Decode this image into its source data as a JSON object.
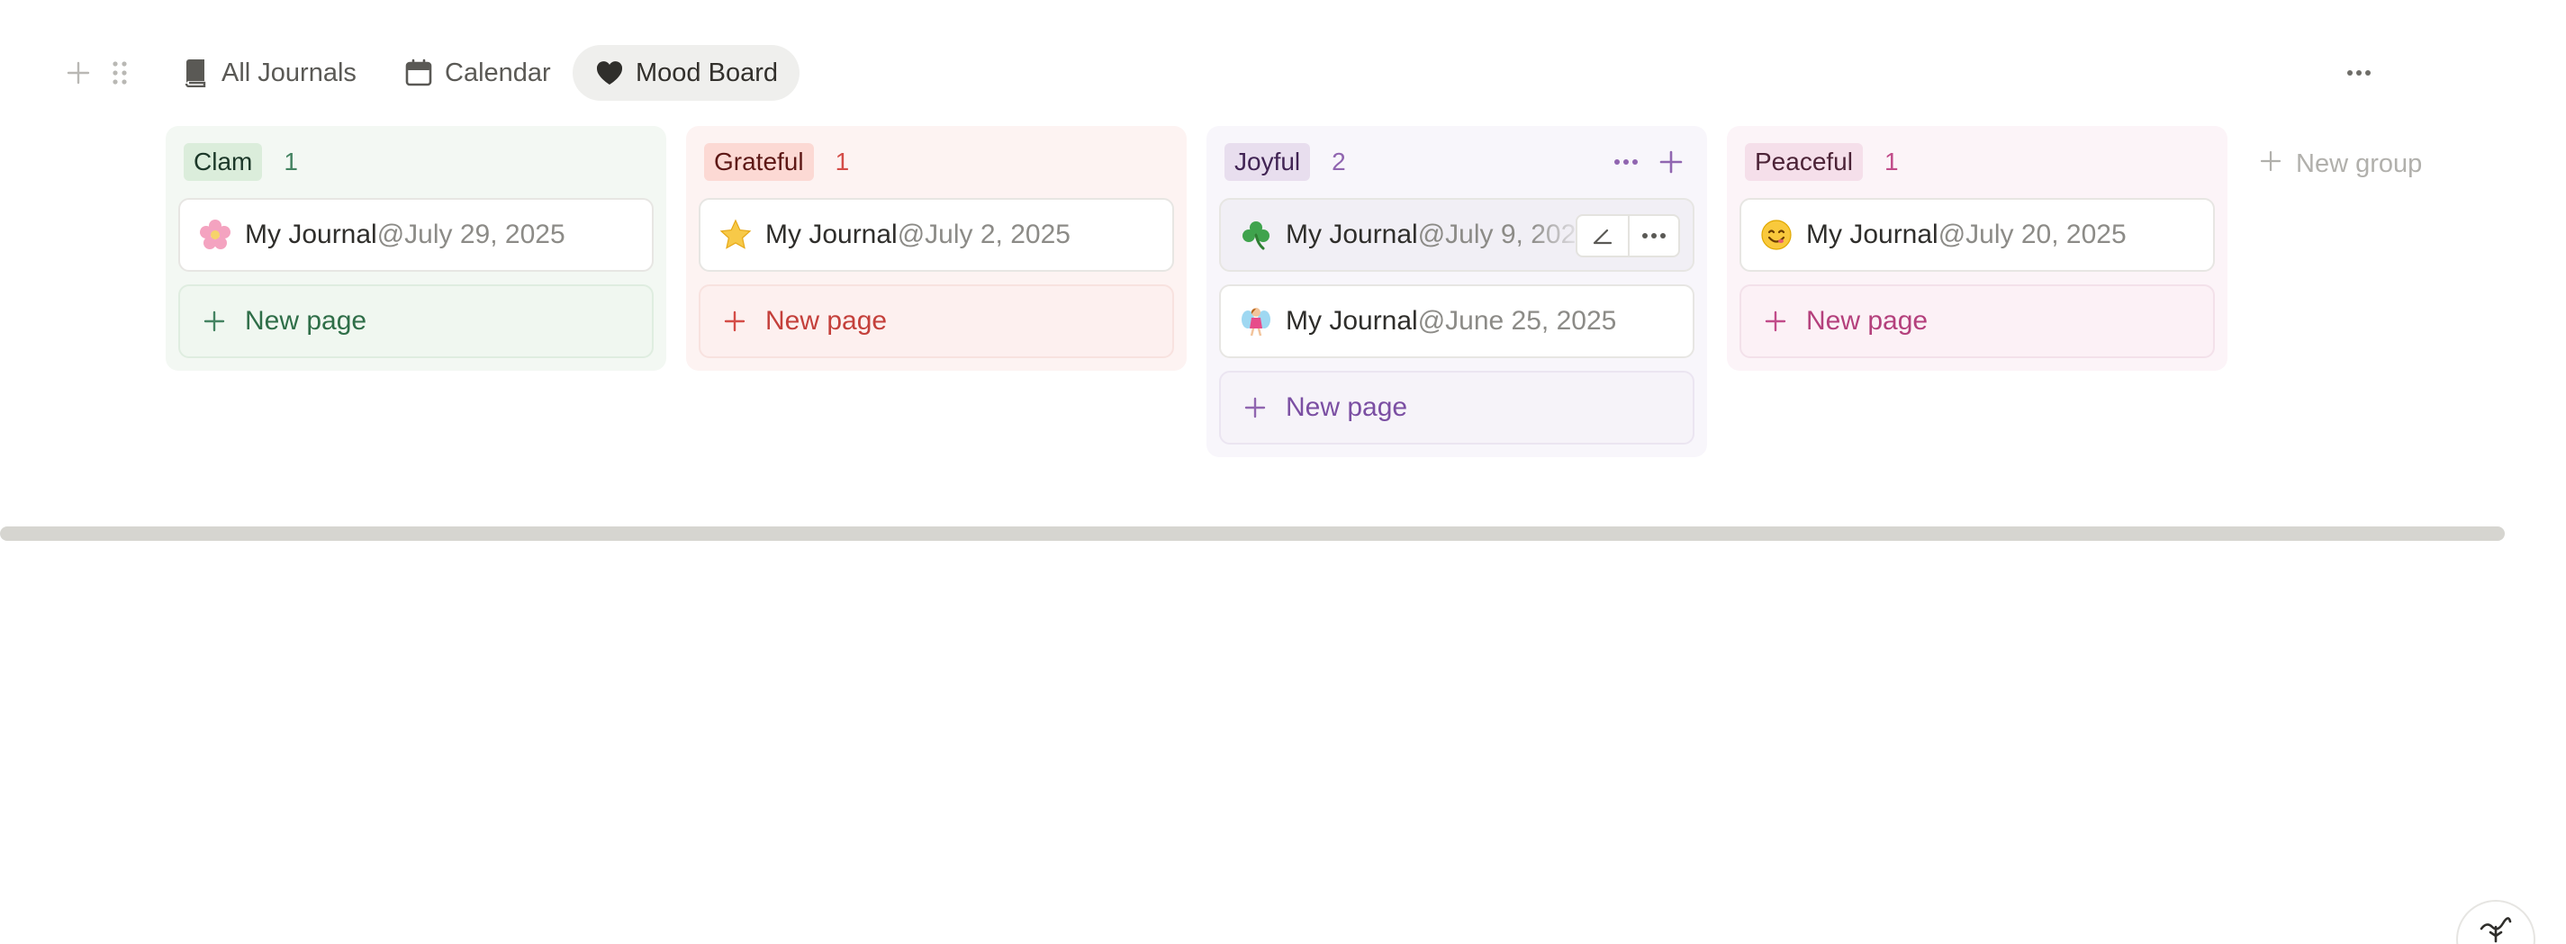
{
  "tabs": [
    {
      "label": "All Journals",
      "icon": "book-icon"
    },
    {
      "label": "Calendar",
      "icon": "calendar-icon"
    },
    {
      "label": "Mood Board",
      "icon": "heart-icon",
      "active": true
    }
  ],
  "board": {
    "new_group_label": "New group",
    "groups": [
      {
        "name": "Clam",
        "count": "1",
        "color": "#448361",
        "cards": [
          {
            "emoji": "flower-icon",
            "title": "My Journal",
            "date": "@July 29, 2025"
          }
        ],
        "new_page_label": "New page"
      },
      {
        "name": "Grateful",
        "count": "1",
        "color": "#d44c47",
        "cards": [
          {
            "emoji": "star-icon",
            "title": "My Journal",
            "date": "@July 2, 2025"
          }
        ],
        "new_page_label": "New page"
      },
      {
        "name": "Joyful",
        "count": "2",
        "color": "#9065b0",
        "cards": [
          {
            "emoji": "clover-icon",
            "title": "My Journal",
            "date": "@July 9, 2025"
          },
          {
            "emoji": "fairy-icon",
            "title": "My Journal",
            "date": "@June 25, 2025"
          }
        ],
        "new_page_label": "New page"
      },
      {
        "name": "Peaceful",
        "count": "1",
        "color": "#c14c8a",
        "cards": [
          {
            "emoji": "smile-icon",
            "title": "My Journal",
            "date": "@July 20, 2025"
          }
        ],
        "new_page_label": "New page"
      }
    ]
  }
}
